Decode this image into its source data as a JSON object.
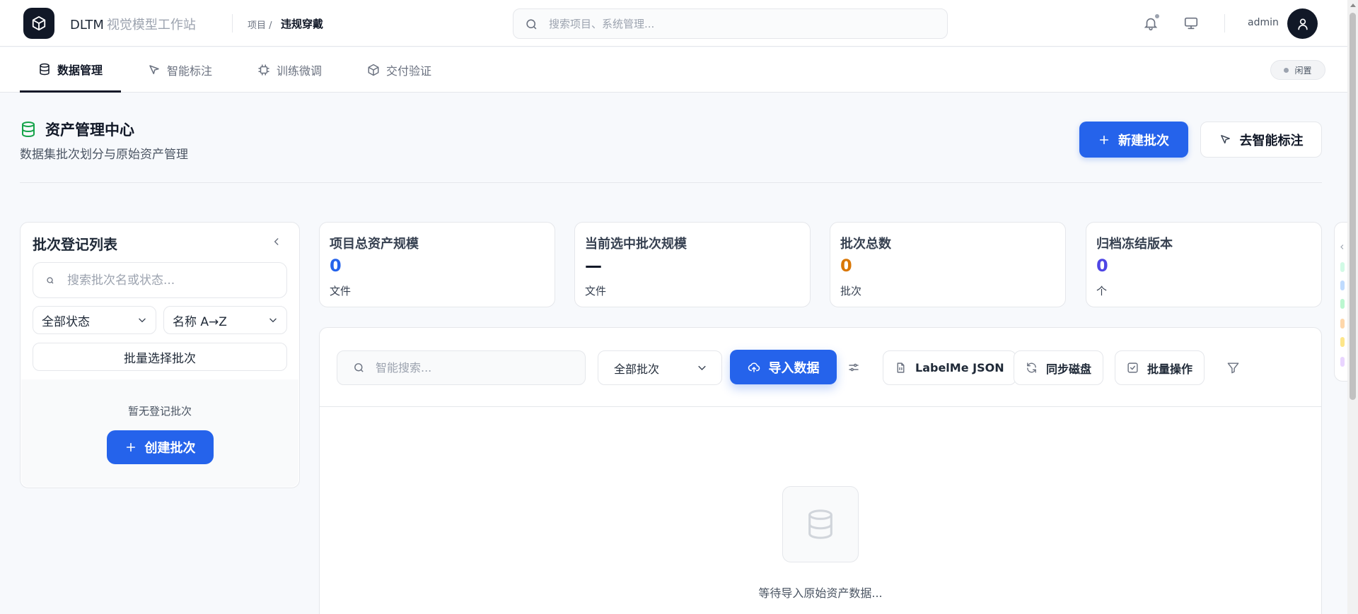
{
  "app": {
    "name": "DLTM",
    "subtitle": "视觉模型工作站"
  },
  "breadcrumb": {
    "prefix": "项目 /",
    "current": "违规穿戴"
  },
  "global_search": {
    "placeholder": "搜索项目、系统管理..."
  },
  "user": {
    "name": "admin"
  },
  "tabs": [
    {
      "label": "数据管理",
      "icon": "database-icon",
      "active": true
    },
    {
      "label": "智能标注",
      "icon": "cursor-icon",
      "active": false
    },
    {
      "label": "训练微调",
      "icon": "chip-icon",
      "active": false
    },
    {
      "label": "交付验证",
      "icon": "box-icon",
      "active": false
    }
  ],
  "status": {
    "label": "闲置"
  },
  "page": {
    "title": "资产管理中心",
    "subtitle": "数据集批次划分与原始资产管理",
    "new_batch_label": "新建批次",
    "go_annotate_label": "去智能标注"
  },
  "batch_list": {
    "title": "批次登记列表",
    "search_placeholder": "搜索批次名或状态...",
    "status_filter": "全部状态",
    "sort": "名称 A→Z",
    "bulk_select_label": "批量选择批次",
    "empty_text": "暂无登记批次",
    "create_label": "创建批次"
  },
  "stats": [
    {
      "label": "项目总资产规模",
      "value": "0",
      "unit": "文件",
      "color": "#2563eb"
    },
    {
      "label": "当前选中批次规模",
      "value": "—",
      "unit": "文件",
      "color": "#111827"
    },
    {
      "label": "批次总数",
      "value": "0",
      "unit": "批次",
      "color": "#d97706"
    },
    {
      "label": "归档冻结版本",
      "value": "0",
      "unit": "个",
      "color": "#4f46e5"
    }
  ],
  "toolbar": {
    "search_placeholder": "智能搜索...",
    "batch_select": "全部批次",
    "import_label": "导入数据",
    "labelme_label": "LabelMe JSON",
    "sync_label": "同步磁盘",
    "bulk_label": "批量操作"
  },
  "empty_state": {
    "text": "等待导入原始资产数据..."
  },
  "colors": {
    "primary": "#2563eb",
    "dark": "#111827",
    "accent_green": "#16a34a"
  }
}
